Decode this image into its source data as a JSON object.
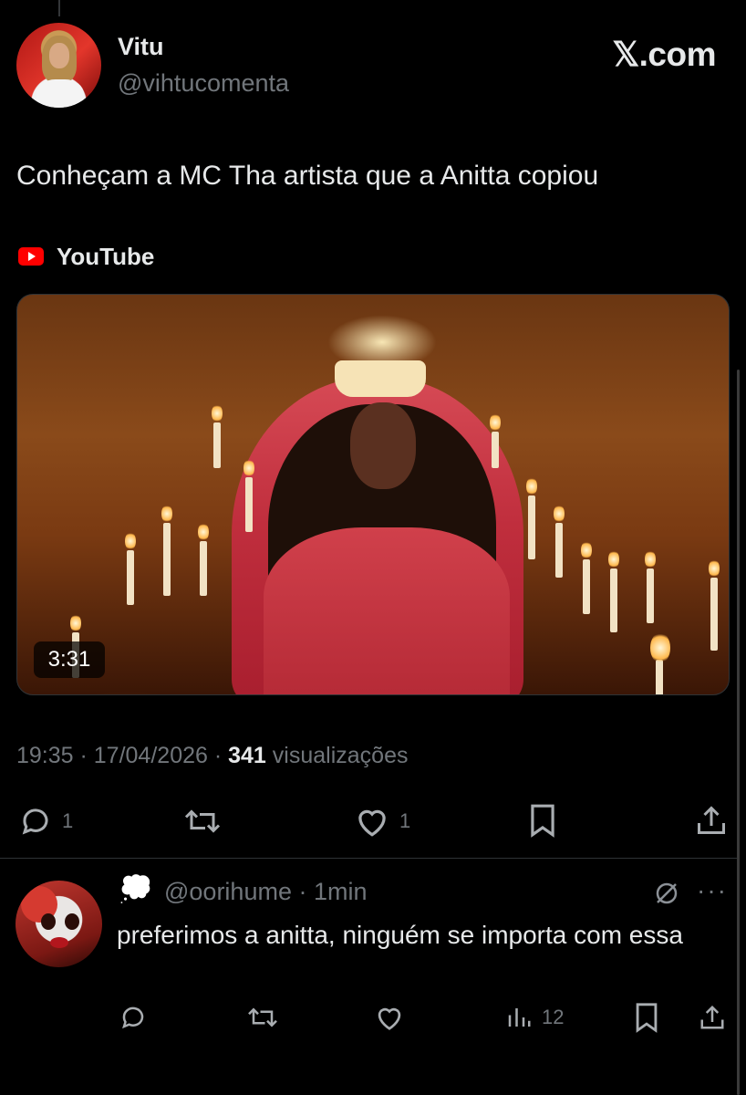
{
  "tweet": {
    "author_name": "Vitu",
    "author_handle": "@vihtucomenta",
    "brand": "𝕏.com",
    "text": "Conheçam a MC Tha artista que a Anitta copiou",
    "source": {
      "icon": "youtube-icon",
      "label": "YouTube"
    },
    "media": {
      "type": "video-thumbnail",
      "duration": "3:31"
    },
    "timestamp": "19:35 · 17/04/2026 · ",
    "views_count": "341",
    "views_label": " visualizações",
    "actions": {
      "reply_count": "1",
      "like_count": "1"
    }
  },
  "reply": {
    "emoji": "💭",
    "handle_time": "@oorihume · 1min",
    "text": "preferimos a anitta, ninguém se importa com essa",
    "views_count": "12",
    "more": "···"
  },
  "colors": {
    "background": "#000000",
    "text_primary": "#e7e9ea",
    "text_secondary": "#71767b",
    "divider": "#2f3336",
    "youtube_red": "#ff0000"
  }
}
